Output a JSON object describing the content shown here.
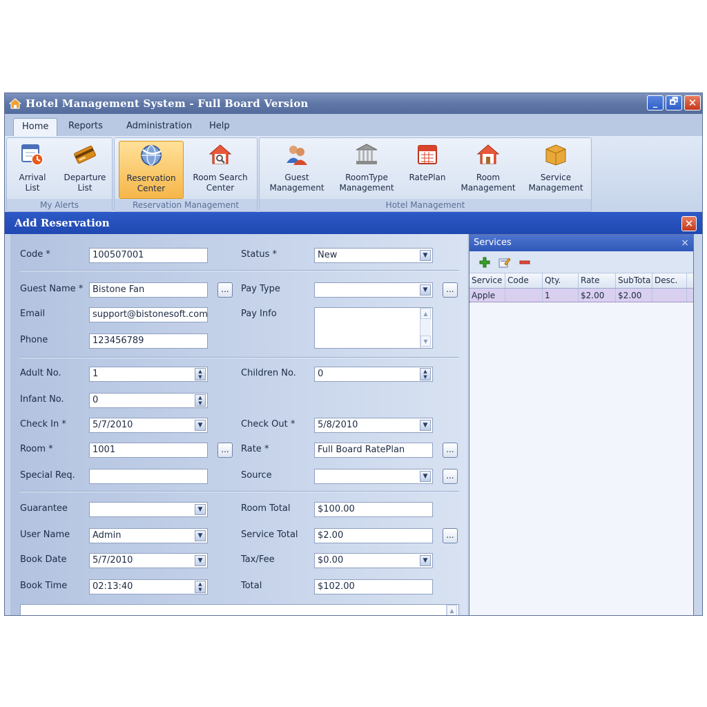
{
  "window": {
    "title": "Hotel Management System - Full Board Version",
    "minimize": "_",
    "maximize": "🗗",
    "close": "✕"
  },
  "menu": [
    "Home",
    "Reports",
    "Administration",
    "Help"
  ],
  "ribbon": {
    "groups": [
      {
        "label": "My Alerts",
        "buttons": [
          {
            "line1": "Arrival",
            "line2": "List",
            "icon": "calendar-clock-icon"
          },
          {
            "line1": "Departure",
            "line2": "List",
            "icon": "credit-card-icon"
          }
        ]
      },
      {
        "label": "Reservation Management",
        "buttons": [
          {
            "line1": "Reservation",
            "line2": "Center",
            "icon": "globe-icon"
          },
          {
            "line1": "Room Search",
            "line2": "Center",
            "icon": "house-search-icon"
          }
        ]
      },
      {
        "label": "Hotel Management",
        "buttons": [
          {
            "line1": "Guest",
            "line2": "Management",
            "icon": "users-icon"
          },
          {
            "line1": "RoomType",
            "line2": "Management",
            "icon": "building-icon"
          },
          {
            "line1": "RatePlan",
            "line2": "",
            "icon": "calendar-icon"
          },
          {
            "line1": "Room",
            "line2": "Management",
            "icon": "house-icon"
          },
          {
            "line1": "Service",
            "line2": "Management",
            "icon": "box-icon"
          }
        ]
      }
    ]
  },
  "dialog": {
    "title": "Add Reservation",
    "close": "✕",
    "ellipsis": "...",
    "fields": {
      "code": {
        "label": "Code *",
        "value": "100507001"
      },
      "status": {
        "label": "Status *",
        "value": "New"
      },
      "guest_name": {
        "label": "Guest Name *",
        "value": "Bistone Fan"
      },
      "pay_type": {
        "label": "Pay Type",
        "value": ""
      },
      "email": {
        "label": "Email",
        "value": "support@bistonesoft.com"
      },
      "pay_info": {
        "label": "Pay Info",
        "value": ""
      },
      "phone": {
        "label": "Phone",
        "value": "123456789"
      },
      "adult_no": {
        "label": "Adult No.",
        "value": "1"
      },
      "children_no": {
        "label": "Children No.",
        "value": "0"
      },
      "infant_no": {
        "label": "Infant No.",
        "value": "0"
      },
      "check_in": {
        "label": "Check In *",
        "value": "5/7/2010"
      },
      "check_out": {
        "label": "Check Out *",
        "value": "5/8/2010"
      },
      "room": {
        "label": "Room *",
        "value": "1001"
      },
      "rate": {
        "label": "Rate *",
        "value": "Full Board RatePlan"
      },
      "special_req": {
        "label": "Special Req.",
        "value": ""
      },
      "source": {
        "label": "Source",
        "value": ""
      },
      "guarantee": {
        "label": "Guarantee",
        "value": ""
      },
      "room_total": {
        "label": "Room Total",
        "value": "$100.00"
      },
      "user_name": {
        "label": "User Name",
        "value": "Admin"
      },
      "service_total": {
        "label": "Service Total",
        "value": "$2.00"
      },
      "book_date": {
        "label": "Book Date",
        "value": "5/7/2010"
      },
      "tax_fee": {
        "label": "Tax/Fee",
        "value": "$0.00"
      },
      "book_time": {
        "label": "Book Time",
        "value": "02:13:40"
      },
      "total": {
        "label": "Total",
        "value": "$102.00"
      }
    }
  },
  "services": {
    "title": "Services",
    "close": "×",
    "toolbar": {
      "add": "+",
      "edit": "edit",
      "remove": "−"
    },
    "columns": [
      "Service",
      "Code",
      "Qty.",
      "Rate",
      "SubTota",
      "Desc."
    ],
    "rows": [
      [
        "Apple",
        "",
        "1",
        "$2.00",
        "$2.00",
        ""
      ]
    ]
  },
  "colors": {
    "title_bar": "#5f77a6",
    "dialog_title": "#2d59c6",
    "selected_ribbon": "#f6b64a",
    "selected_row": "#d9cfee"
  }
}
